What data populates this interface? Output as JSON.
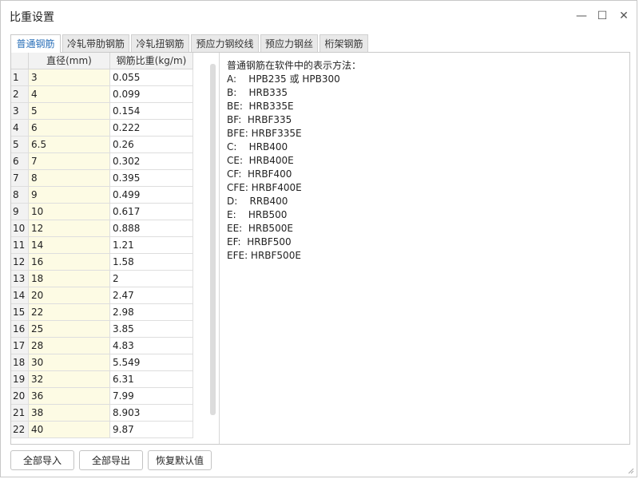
{
  "window": {
    "title": "比重设置",
    "controls": {
      "minimize": "—",
      "maximize": "☐",
      "close": "✕"
    }
  },
  "tabs": [
    {
      "label": "普通钢筋"
    },
    {
      "label": "冷轧带肋钢筋"
    },
    {
      "label": "冷轧扭钢筋"
    },
    {
      "label": "预应力钢绞线"
    },
    {
      "label": "预应力钢丝"
    },
    {
      "label": "桁架钢筋"
    }
  ],
  "active_tab": "普通钢筋",
  "table": {
    "headers": {
      "index": "",
      "diameter": "直径(mm)",
      "weight": "钢筋比重(kg/m)"
    },
    "rows": [
      {
        "idx": "1",
        "diameter": "3",
        "weight": "0.055"
      },
      {
        "idx": "2",
        "diameter": "4",
        "weight": "0.099"
      },
      {
        "idx": "3",
        "diameter": "5",
        "weight": "0.154"
      },
      {
        "idx": "4",
        "diameter": "6",
        "weight": "0.222"
      },
      {
        "idx": "5",
        "diameter": "6.5",
        "weight": "0.26"
      },
      {
        "idx": "6",
        "diameter": "7",
        "weight": "0.302"
      },
      {
        "idx": "7",
        "diameter": "8",
        "weight": "0.395"
      },
      {
        "idx": "8",
        "diameter": "9",
        "weight": "0.499"
      },
      {
        "idx": "9",
        "diameter": "10",
        "weight": "0.617"
      },
      {
        "idx": "10",
        "diameter": "12",
        "weight": "0.888"
      },
      {
        "idx": "11",
        "diameter": "14",
        "weight": "1.21"
      },
      {
        "idx": "12",
        "diameter": "16",
        "weight": "1.58"
      },
      {
        "idx": "13",
        "diameter": "18",
        "weight": "2"
      },
      {
        "idx": "14",
        "diameter": "20",
        "weight": "2.47"
      },
      {
        "idx": "15",
        "diameter": "22",
        "weight": "2.98"
      },
      {
        "idx": "16",
        "diameter": "25",
        "weight": "3.85"
      },
      {
        "idx": "17",
        "diameter": "28",
        "weight": "4.83"
      },
      {
        "idx": "18",
        "diameter": "30",
        "weight": "5.549"
      },
      {
        "idx": "19",
        "diameter": "32",
        "weight": "6.31"
      },
      {
        "idx": "20",
        "diameter": "36",
        "weight": "7.99"
      },
      {
        "idx": "21",
        "diameter": "38",
        "weight": "8.903"
      },
      {
        "idx": "22",
        "diameter": "40",
        "weight": "9.87"
      }
    ]
  },
  "info": {
    "lines": [
      "普通钢筋在软件中的表示方法：",
      "A:    HPB235 或 HPB300",
      "B:    HRB335",
      "BE:  HRB335E",
      "BF:  HRBF335",
      "BFE: HRBF335E",
      "C:    HRB400",
      "CE:  HRB400E",
      "CF:  HRBF400",
      "CFE: HRBF400E",
      "D:    RRB400",
      "E:    HRB500",
      "EE:  HRB500E",
      "EF:  HRBF500",
      "EFE: HRBF500E"
    ]
  },
  "buttons": {
    "import_all": "全部导入",
    "export_all": "全部导出",
    "restore_defaults": "恢复默认值"
  },
  "colors": {
    "active_tab_text": "#2a6fb8",
    "diameter_column_bg": "#fdfbe4"
  }
}
